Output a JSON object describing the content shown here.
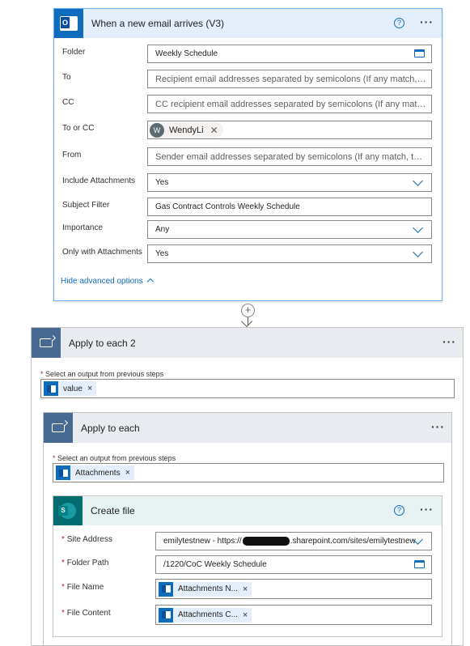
{
  "trigger": {
    "title": "When a new email arrives (V3)",
    "help": "?",
    "more": "···",
    "fields": {
      "folder": {
        "label": "Folder",
        "value": "Weekly Schedule"
      },
      "to": {
        "label": "To",
        "placeholder": "Recipient email addresses separated by semicolons (If any match, t..."
      },
      "cc": {
        "label": "CC",
        "placeholder": "CC recipient email addresses separated by semicolons (If any matc..."
      },
      "to_or_cc": {
        "label": "To or CC",
        "person_initial": "W",
        "person_name": "WendyLi",
        "remove": "✕"
      },
      "from": {
        "label": "From",
        "placeholder": "Sender email addresses separated by semicolons (If any match, the..."
      },
      "include_attachments": {
        "label": "Include Attachments",
        "value": "Yes"
      },
      "subject_filter": {
        "label": "Subject Filter",
        "value": "Gas Contract Controls Weekly Schedule"
      },
      "importance": {
        "label": "Importance",
        "value": "Any"
      },
      "only_with_attachments": {
        "label": "Only with Attachments",
        "value": "Yes"
      }
    },
    "hide_advanced": "Hide advanced options"
  },
  "connector": {
    "plus": "+"
  },
  "apply_each_2": {
    "title": "Apply to each 2",
    "more": "···",
    "required_mark": "*",
    "select_label": "Select an output from previous steps",
    "token": {
      "label": "value",
      "remove": "×"
    }
  },
  "apply_each": {
    "title": "Apply to each",
    "more": "···",
    "required_mark": "*",
    "select_label": "Select an output from previous steps",
    "token": {
      "label": "Attachments",
      "remove": "×"
    }
  },
  "create_file": {
    "title": "Create file",
    "help": "?",
    "more": "···",
    "required_mark": "*",
    "site_address": {
      "label": "Site Address",
      "value_prefix": "emilytestnew - https://",
      "value_suffix": ".sharepoint.com/sites/emilytestnew"
    },
    "folder_path": {
      "label": "Folder Path",
      "value": "/1220/CoC Weekly Schedule"
    },
    "file_name": {
      "label": "File Name",
      "token": "Attachments N...",
      "remove": "×"
    },
    "file_content": {
      "label": "File Content",
      "token": "Attachments C...",
      "remove": "×"
    }
  },
  "colors": {
    "accent": "#0f6cbd",
    "loop_icon": "#486991",
    "sharepoint": "#036c70",
    "trigger_header": "#e4eefb"
  }
}
